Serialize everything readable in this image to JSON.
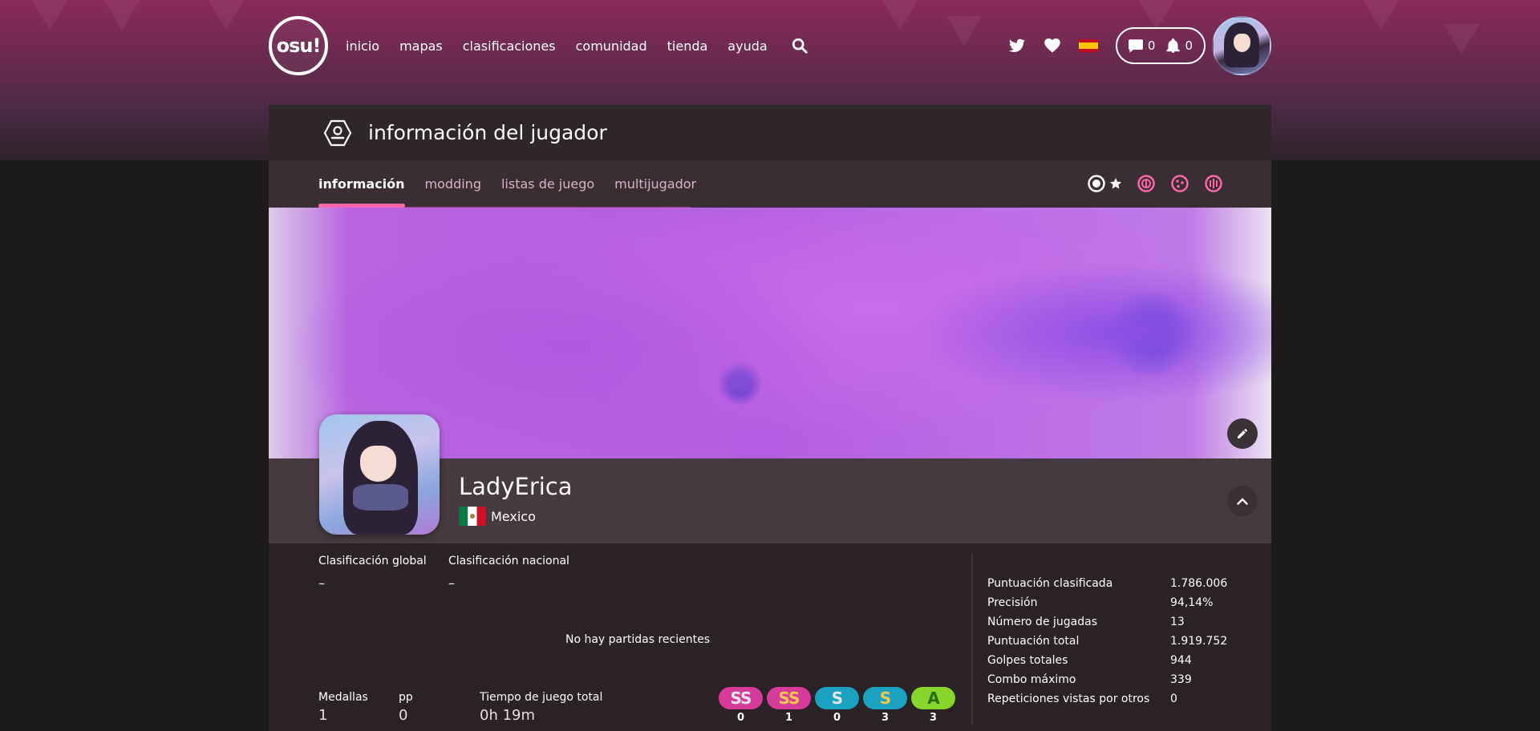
{
  "navbar": {
    "logo_text": "osu!",
    "links": [
      "inicio",
      "mapas",
      "clasificaciones",
      "comunidad",
      "tienda",
      "ayuda"
    ],
    "chat_count": "0",
    "notification_count": "0"
  },
  "header": {
    "title": "información del jugador"
  },
  "tabs": [
    "información",
    "modding",
    "listas de juego",
    "multijugador"
  ],
  "profile": {
    "username": "LadyErica",
    "country": "Mexico"
  },
  "ranks": {
    "global_label": "Clasificación global",
    "global_value": "–",
    "national_label": "Clasificación nacional",
    "national_value": "–"
  },
  "recent": {
    "empty_text": "No hay partidas recientes"
  },
  "bottom_stats": {
    "medals_label": "Medallas",
    "medals_value": "1",
    "pp_label": "pp",
    "pp_value": "0",
    "playtime_label": "Tiempo de juego total",
    "playtime_value": "0h 19m"
  },
  "grades": [
    {
      "grade": "SS",
      "count": "0",
      "color": "#d63a9a"
    },
    {
      "grade": "SS",
      "count": "1",
      "color": "#d63a9a"
    },
    {
      "grade": "S",
      "count": "0",
      "color": "#1aa2c0"
    },
    {
      "grade": "S",
      "count": "3",
      "color": "#1aa2c0"
    },
    {
      "grade": "A",
      "count": "3",
      "color": "#86d62b"
    }
  ],
  "ranked_stats": [
    {
      "label": "Puntuación clasificada",
      "value": "1.786.006"
    },
    {
      "label": "Precisión",
      "value": "94,14%"
    },
    {
      "label": "Número de jugadas",
      "value": "13"
    },
    {
      "label": "Puntuación total",
      "value": "1.919.752"
    },
    {
      "label": "Golpes totales",
      "value": "944"
    },
    {
      "label": "Combo máximo",
      "value": "339"
    },
    {
      "label": "Repeticiones vistas por otros",
      "value": "0"
    }
  ],
  "colors": {
    "accent": "#ff66aa",
    "background": "#2a2226"
  }
}
